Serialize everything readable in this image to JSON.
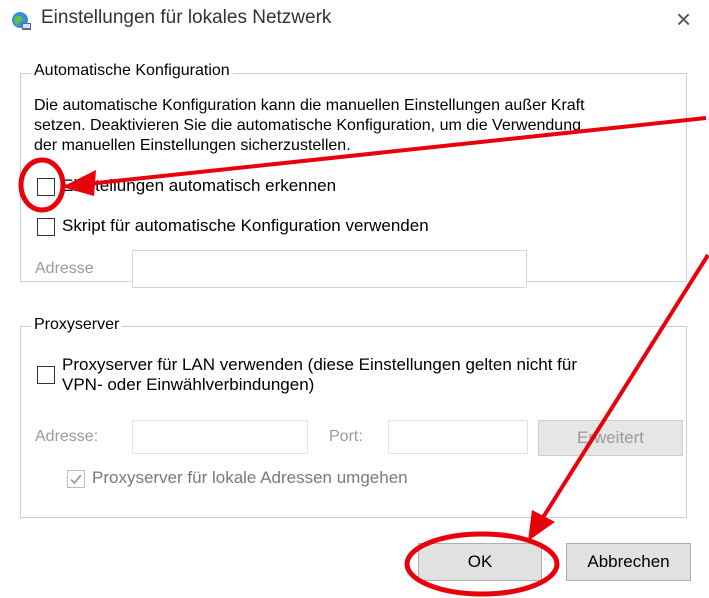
{
  "window": {
    "title": "Einstellungen für lokales Netzwerk",
    "icon": "network-globe-icon",
    "close": "×"
  },
  "auto_config": {
    "legend": "Automatische Konfiguration",
    "description": [
      "Die automatische Konfiguration kann die manuellen Einstellungen außer Kraft",
      "setzen. Deaktivieren Sie die automatische Konfiguration, um die Verwendung",
      "der manuellen Einstellungen sicherzustellen."
    ],
    "detect_label": "Einstellungen automatisch erkennen",
    "detect_checked": false,
    "script_label": "Skript für automatische Konfiguration verwenden",
    "script_checked": false,
    "address_label": "Adresse",
    "address_value": ""
  },
  "proxy": {
    "legend": "Proxyserver",
    "use_proxy_label_line1": "Proxyserver für LAN verwenden (diese Einstellungen gelten nicht für",
    "use_proxy_label_line2": "VPN- oder Einwählverbindungen)",
    "use_proxy_checked": false,
    "address_label": "Adresse:",
    "address_value": "",
    "port_label": "Port:",
    "port_value": "",
    "advanced_label": "Erweitert",
    "bypass_label": "Proxyserver für lokale Adressen umgehen",
    "bypass_checked": true
  },
  "buttons": {
    "ok": "OK",
    "cancel": "Abbrechen"
  },
  "annotation_color": "#e8000b"
}
